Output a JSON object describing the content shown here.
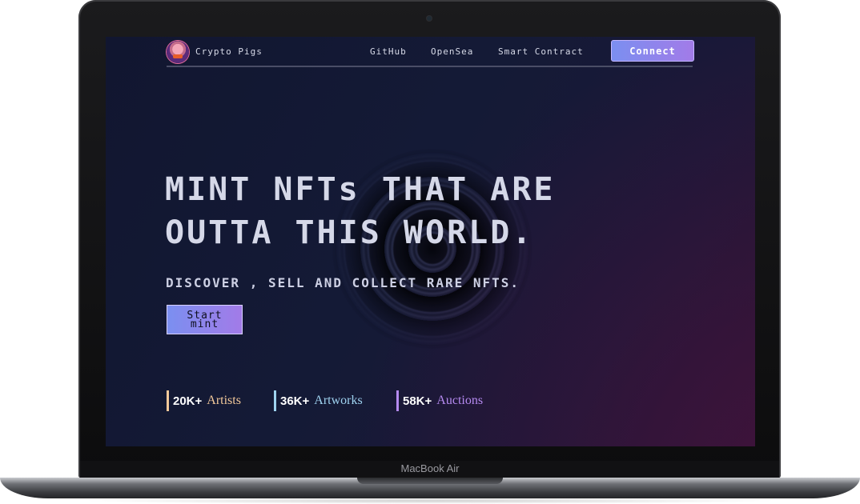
{
  "device": {
    "label": "MacBook Air"
  },
  "nav": {
    "brand": "Crypto Pigs",
    "links": [
      "GitHub",
      "OpenSea",
      "Smart Contract"
    ],
    "connect_label": "Connect"
  },
  "hero": {
    "headline_line1": "MINT NFTs THAT ARE",
    "headline_line2": "OUTTA THIS WORLD.",
    "subheadline": "DISCOVER , SELL AND COLLECT RARE NFTS.",
    "cta_label": "Start mint"
  },
  "stats": [
    {
      "value": "20K+",
      "label": "Artists",
      "color": "#f3c99a"
    },
    {
      "value": "36K+",
      "label": "Artworks",
      "color": "#9fd3f0"
    },
    {
      "value": "58K+",
      "label": "Auctions",
      "color": "#b58af0"
    }
  ],
  "colors": {
    "accent_start": "#7b8ff0",
    "accent_end": "#a27be8",
    "background": "#141a36"
  },
  "icons": {
    "logo": "pig-avatar-icon",
    "camera": "camera-icon"
  }
}
